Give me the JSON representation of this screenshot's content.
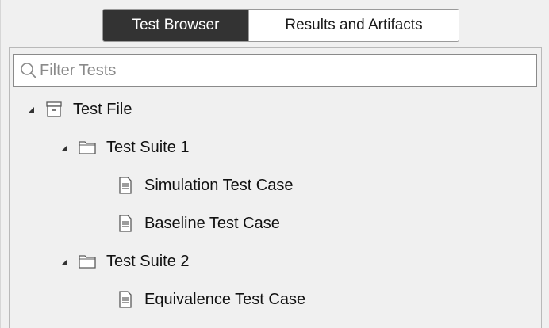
{
  "tabs": [
    {
      "label": "Test Browser",
      "active": true
    },
    {
      "label": "Results and Artifacts",
      "active": false
    }
  ],
  "filter": {
    "placeholder": "Filter Tests",
    "value": ""
  },
  "tree": {
    "file": {
      "label": "Test File",
      "icon": "test-file-icon",
      "expanded": true
    },
    "suites": [
      {
        "label": "Test Suite 1",
        "icon": "folder-icon",
        "expanded": true,
        "cases": [
          {
            "label": "Simulation Test Case",
            "icon": "document-icon"
          },
          {
            "label": "Baseline Test Case",
            "icon": "document-icon"
          }
        ]
      },
      {
        "label": "Test Suite 2",
        "icon": "folder-icon",
        "expanded": true,
        "cases": [
          {
            "label": "Equivalence Test Case",
            "icon": "document-icon"
          }
        ]
      }
    ]
  },
  "colors": {
    "active_tab_bg": "#333333",
    "panel_bg": "#f0f0f0",
    "icon_stroke": "#5a5a5a"
  }
}
